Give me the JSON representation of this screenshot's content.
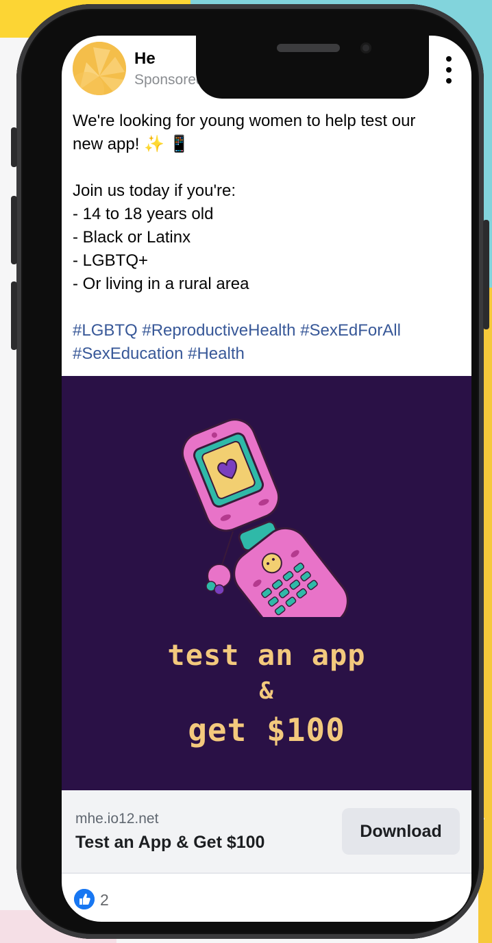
{
  "post": {
    "brand_name": "He",
    "sponsored_label": "Sponsored ·",
    "body_lines": [
      "We're looking for young women to help test our",
      "new app! ✨ 📱",
      "",
      "Join us today if you're:",
      "- 14 to 18 years old",
      "- Black or Latinx",
      "- LGBTQ+",
      "- Or living in a rural area",
      ""
    ],
    "hashtags_line1": [
      "#LGBTQ",
      "#ReproductiveHealth",
      "#SexEdForAll"
    ],
    "hashtags_line2": [
      "#SexEducation",
      "#Health"
    ]
  },
  "creative": {
    "line1": "test an app",
    "line2": "&",
    "line3": "get $100",
    "background_color": "#2a1146",
    "text_color": "#f3c97d"
  },
  "link": {
    "domain": "mhe.io12.net",
    "title": "Test an App & Get $100",
    "cta_label": "Download"
  },
  "reactions": {
    "like_count": "2",
    "like_color": "#1877f2"
  },
  "icons": [
    "globe-icon",
    "close-icon",
    "more-icon",
    "like-icon"
  ]
}
